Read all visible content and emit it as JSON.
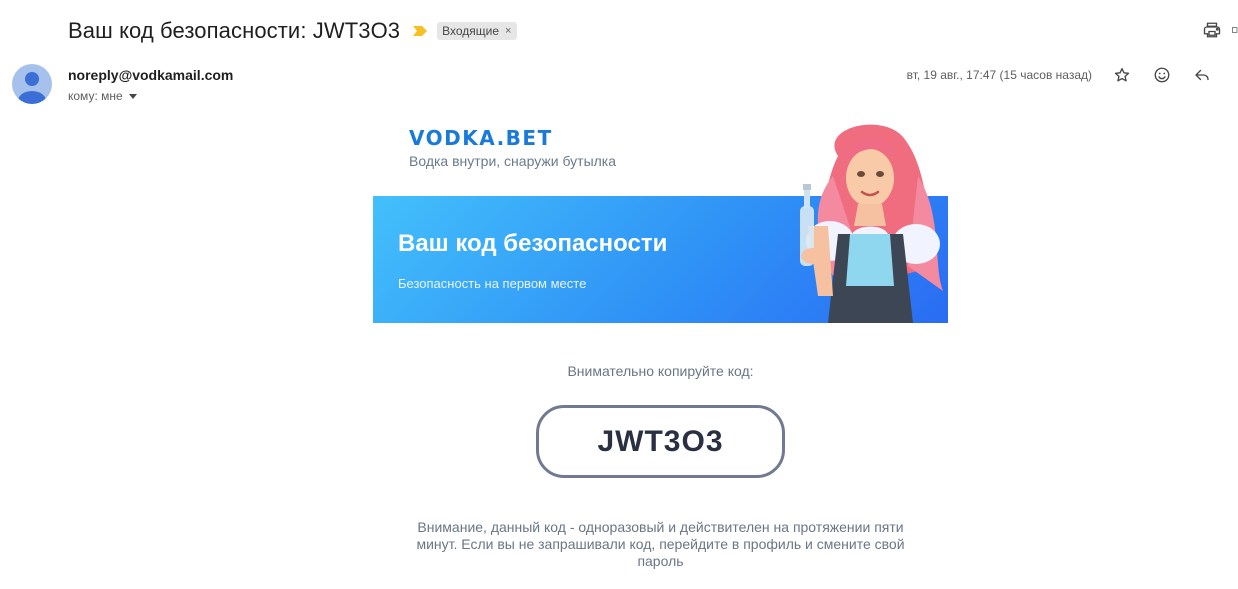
{
  "subject": "Ваш код безопасности: JWT3O3",
  "label": {
    "name": "Входящие",
    "remove": "×"
  },
  "sender": {
    "email": "noreply@vodkamail.com",
    "to": "кому: мне"
  },
  "meta": {
    "date": "вт, 19 авг., 17:47 (15 часов назад)"
  },
  "email": {
    "brand": "VODKA.BET",
    "tagline": "Водка внутри, снаружи бутылка",
    "banner_title": "Ваш код безопасности",
    "banner_subtitle": "Безопасность на первом месте",
    "copy_label": "Внимательно копируйте код:",
    "code": "JWT3O3",
    "notice": "Внимание, данный код - одноразовый и действителен на протяжении пяти минут. Если вы не запрашивали код, перейдите в профиль и смените свой пароль"
  },
  "icons": {
    "important": "important-marker-icon",
    "print": "print-icon",
    "new_window": "open-new-window-icon",
    "star": "star-icon",
    "emoji": "emoji-reaction-icon",
    "reply": "reply-icon"
  },
  "colors": {
    "brand_blue": "#1a7ad8",
    "banner_start": "#43c0fb",
    "banner_end": "#2a6cf3",
    "important_marker": "#f6bf26",
    "code_border": "#727a91"
  }
}
